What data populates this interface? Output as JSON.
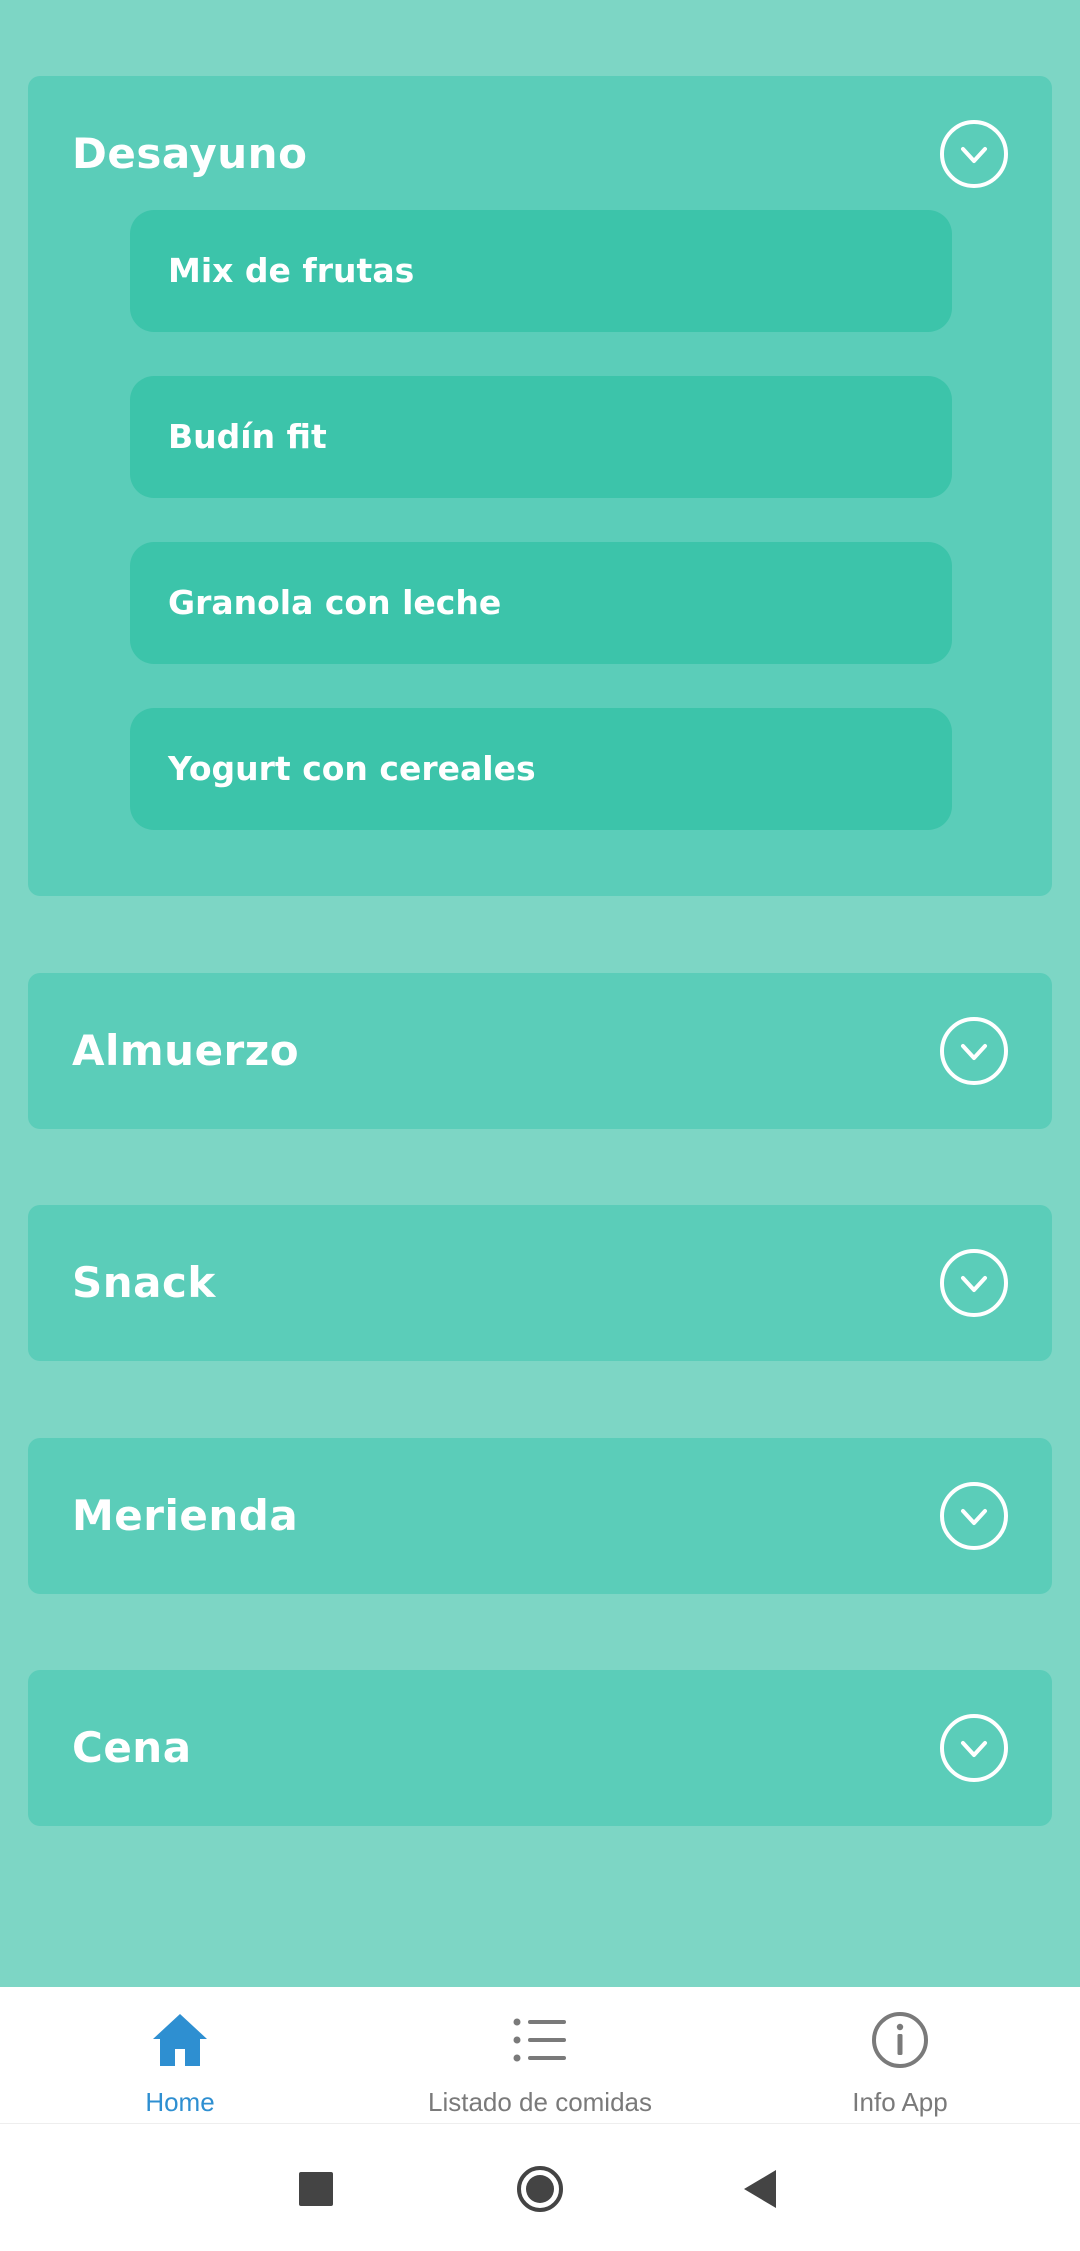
{
  "sections": [
    {
      "title": "Desayuno",
      "expanded": true,
      "items": [
        "Mix de frutas",
        "Budín fit",
        "Granola con leche",
        "Yogurt con cereales"
      ]
    },
    {
      "title": "Almuerzo",
      "expanded": false
    },
    {
      "title": "Snack",
      "expanded": false
    },
    {
      "title": "Merienda",
      "expanded": false
    },
    {
      "title": "Cena",
      "expanded": false
    }
  ],
  "bottom_nav": [
    {
      "label": "Home",
      "icon": "home-icon",
      "active": true
    },
    {
      "label": "Listado de comidas",
      "icon": "list-icon",
      "active": false
    },
    {
      "label": "Info App",
      "icon": "info-icon",
      "active": false
    }
  ],
  "system_nav": [
    "square-recents-icon",
    "circle-home-icon",
    "triangle-back-icon"
  ],
  "colors": {
    "background": "#7dd6c5",
    "section": "#5bcdb9",
    "item": "#3cc4aa",
    "accent": "#2e8fd1"
  }
}
